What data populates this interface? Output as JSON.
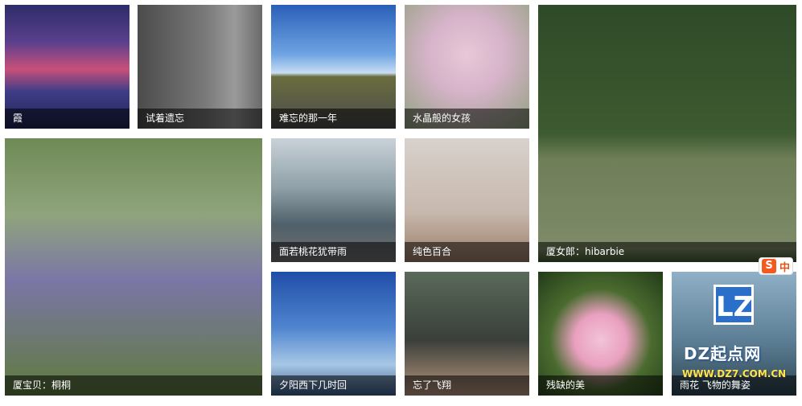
{
  "gallery": {
    "items": [
      {
        "caption": "霞"
      },
      {
        "caption": "试着遗忘"
      },
      {
        "caption": "难忘的那一年"
      },
      {
        "caption": "水晶般的女孩"
      },
      {
        "caption": "厦女郎：hibarbie"
      },
      {
        "caption": "厦宝贝：桐桐"
      },
      {
        "caption": "面若桃花犹带雨"
      },
      {
        "caption": "纯色百合"
      },
      {
        "caption": "夕阳西下几时回"
      },
      {
        "caption": "忘了飞翔"
      },
      {
        "caption": "残缺的美"
      },
      {
        "caption": "雨花 飞物的舞姿"
      }
    ]
  },
  "watermark": {
    "logo": "LZ",
    "name": "DZ起点网",
    "url": "WWW.DZ7.COM.CN"
  },
  "ime_badge": {
    "logo": "S",
    "mode": "中"
  }
}
